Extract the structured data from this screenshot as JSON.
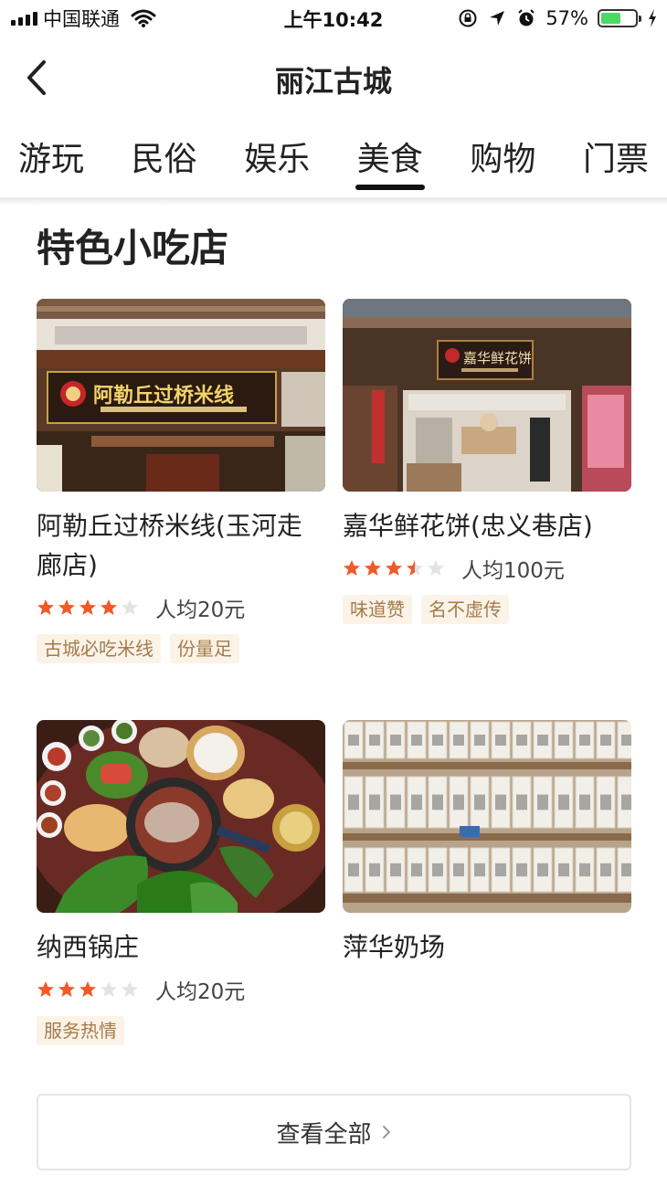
{
  "status_bar": {
    "carrier": "中国联通",
    "time": "上午10:42",
    "battery_pct": "57%",
    "battery_level": 0.57
  },
  "nav": {
    "title": "丽江古城"
  },
  "tabs": [
    {
      "label": "游玩",
      "active": false
    },
    {
      "label": "民俗",
      "active": false
    },
    {
      "label": "娱乐",
      "active": false
    },
    {
      "label": "美食",
      "active": true
    },
    {
      "label": "购物",
      "active": false
    },
    {
      "label": "门票",
      "active": false
    }
  ],
  "section": {
    "title": "特色小吃店"
  },
  "cards": [
    {
      "name": "阿勒丘过桥米线(玉河走廊店)",
      "rating": 4,
      "price": "人均20元",
      "tags": [
        "古城必吃米线",
        "份量足"
      ],
      "sign_text": "阿勒丘过桥米线"
    },
    {
      "name": "嘉华鲜花饼(忠义巷店)",
      "rating": 3.5,
      "price": "人均100元",
      "tags": [
        "味道赞",
        "名不虚传"
      ],
      "sign_text": "嘉华鲜花饼"
    },
    {
      "name": "纳西锅庄",
      "rating": 3,
      "price": "人均20元",
      "tags": [
        "服务热情"
      ]
    },
    {
      "name": "萍华奶场"
    }
  ],
  "view_all": {
    "label": "查看全部"
  },
  "colors": {
    "star_on": "#f05a28",
    "star_off": "#e3e3e3",
    "tag_bg": "#fbf3e8",
    "tag_text": "#a47b4a"
  }
}
